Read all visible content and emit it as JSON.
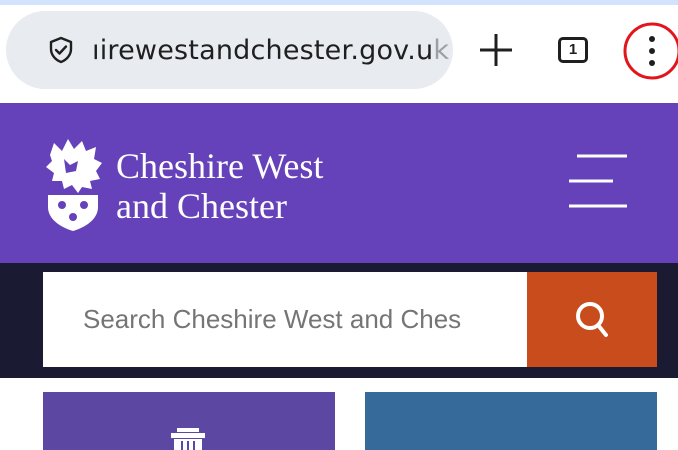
{
  "browser": {
    "url_text": "ıirewestandchester.gov.u",
    "url_fade": "k",
    "tab_count": "1",
    "icons": {
      "security": "shield-check-icon",
      "new_tab": "plus-icon",
      "tabs": "tab-count-icon",
      "menu": "more-vert-icon"
    },
    "menu_highlight_color": "#e2151b"
  },
  "header": {
    "brand_line1": "Cheshire West",
    "brand_line2": "and Chester",
    "background": "#6542b9",
    "icons": {
      "logo": "lion-crest-logo",
      "menu": "hamburger-menu-icon"
    }
  },
  "search": {
    "placeholder": "Search Cheshire West and Ches",
    "button_color": "#c94d1c",
    "icons": {
      "submit": "search-icon"
    }
  },
  "tiles": [
    {
      "color": "#5c48a3",
      "icon": "bin-icon"
    },
    {
      "color": "#356a9a"
    }
  ]
}
